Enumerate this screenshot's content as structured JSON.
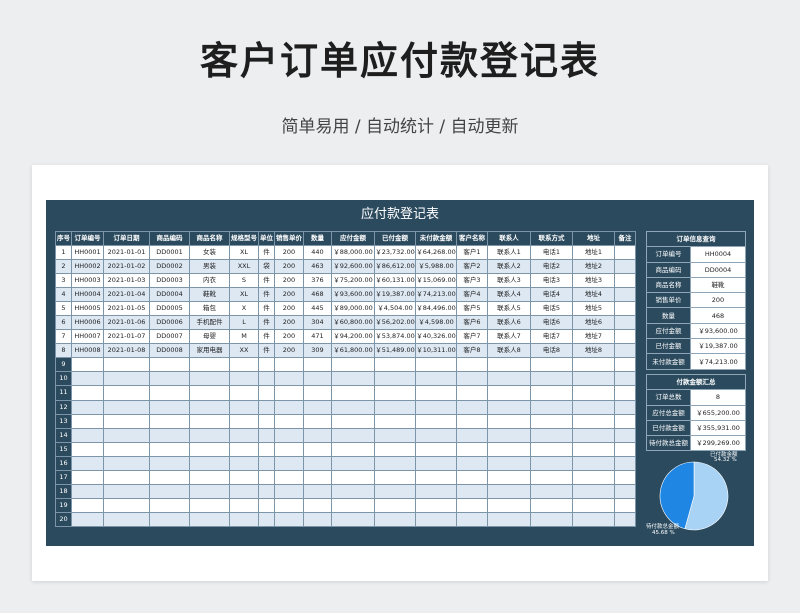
{
  "page": {
    "title": "客户订单应付款登记表",
    "subtitle": "简单易用 / 自动统计 / 自动更新"
  },
  "sheet": {
    "title": "应付款登记表",
    "headers": [
      "序号",
      "订单编号",
      "订单日期",
      "商品编码",
      "商品名称",
      "规格型号",
      "单位",
      "销售单价",
      "数量",
      "应付金额",
      "已付金额",
      "未付款金额",
      "客户名称",
      "联系人",
      "联系方式",
      "地址",
      "备注"
    ],
    "rows": [
      [
        "1",
        "HH0001",
        "2021-01-01",
        "DD0001",
        "女装",
        "XL",
        "件",
        "200",
        "440",
        "￥88,000.00",
        "￥23,732.00",
        "￥64,268.00",
        "客户1",
        "联系人1",
        "电话1",
        "地址1",
        ""
      ],
      [
        "2",
        "HH0002",
        "2021-01-02",
        "DD0002",
        "男装",
        "XXL",
        "袋",
        "200",
        "463",
        "￥92,600.00",
        "￥86,612.00",
        "￥5,988.00",
        "客户2",
        "联系人2",
        "电话2",
        "地址2",
        ""
      ],
      [
        "3",
        "HH0003",
        "2021-01-03",
        "DD0003",
        "内衣",
        "S",
        "件",
        "200",
        "376",
        "￥75,200.00",
        "￥60,131.00",
        "￥15,069.00",
        "客户3",
        "联系人3",
        "电话3",
        "地址3",
        ""
      ],
      [
        "4",
        "HH0004",
        "2021-01-04",
        "DD0004",
        "鞋靴",
        "XL",
        "件",
        "200",
        "468",
        "￥93,600.00",
        "￥19,387.00",
        "￥74,213.00",
        "客户4",
        "联系人4",
        "电话4",
        "地址4",
        ""
      ],
      [
        "5",
        "HH0005",
        "2021-01-05",
        "DD0005",
        "箱包",
        "X",
        "件",
        "200",
        "445",
        "￥89,000.00",
        "￥4,504.00",
        "￥84,496.00",
        "客户5",
        "联系人5",
        "电话5",
        "地址5",
        ""
      ],
      [
        "6",
        "HH0006",
        "2021-01-06",
        "DD0006",
        "手机配件",
        "L",
        "件",
        "200",
        "304",
        "￥60,800.00",
        "￥56,202.00",
        "￥4,598.00",
        "客户6",
        "联系人6",
        "电话6",
        "地址6",
        ""
      ],
      [
        "7",
        "HH0007",
        "2021-01-07",
        "DD0007",
        "母婴",
        "M",
        "件",
        "200",
        "471",
        "￥94,200.00",
        "￥53,874.00",
        "￥40,326.00",
        "客户7",
        "联系人7",
        "电话7",
        "地址7",
        ""
      ],
      [
        "8",
        "HH0008",
        "2021-01-08",
        "DD0008",
        "家用电器",
        "XX",
        "件",
        "200",
        "309",
        "￥61,800.00",
        "￥51,489.00",
        "￥10,311.00",
        "客户8",
        "联系人8",
        "电话8",
        "地址8",
        ""
      ]
    ],
    "empty_row_numbers": [
      "9",
      "10",
      "11",
      "12",
      "13",
      "14",
      "15",
      "16",
      "17",
      "18",
      "19",
      "20"
    ]
  },
  "order_query": {
    "title": "订单信息查询",
    "rows": [
      {
        "label": "订单编号",
        "value": "HH0004"
      },
      {
        "label": "商品编码",
        "value": "DD0004"
      },
      {
        "label": "商品名称",
        "value": "鞋靴"
      },
      {
        "label": "销售单价",
        "value": "200"
      },
      {
        "label": "数量",
        "value": "468"
      },
      {
        "label": "应付金额",
        "value": "￥93,600.00"
      },
      {
        "label": "已付金额",
        "value": "￥19,387.00"
      },
      {
        "label": "未付款金额",
        "value": "￥74,213.00"
      }
    ]
  },
  "summary": {
    "title": "付款金额汇总",
    "rows": [
      {
        "label": "订单总数",
        "value": "8"
      },
      {
        "label": "应付总金额",
        "value": "￥655,200.00"
      },
      {
        "label": "已付款金额",
        "value": "￥355,931.00"
      },
      {
        "label": "待付款总金额",
        "value": "￥299,269.00"
      }
    ]
  },
  "chart_data": {
    "type": "pie",
    "slices": [
      {
        "name": "已付款金额",
        "percent": 54.32,
        "label": "54.32 %",
        "color": "#a9d3f5"
      },
      {
        "name": "待付款总金额",
        "percent": 45.68,
        "label": "45.68 %",
        "color": "#1f86e3"
      }
    ]
  },
  "colors": {
    "sheet_bg": "#2b4a5e",
    "row_alt": "#dde8f3",
    "paid_slice": "#a9d3f5",
    "unpaid_slice": "#1f86e3"
  }
}
